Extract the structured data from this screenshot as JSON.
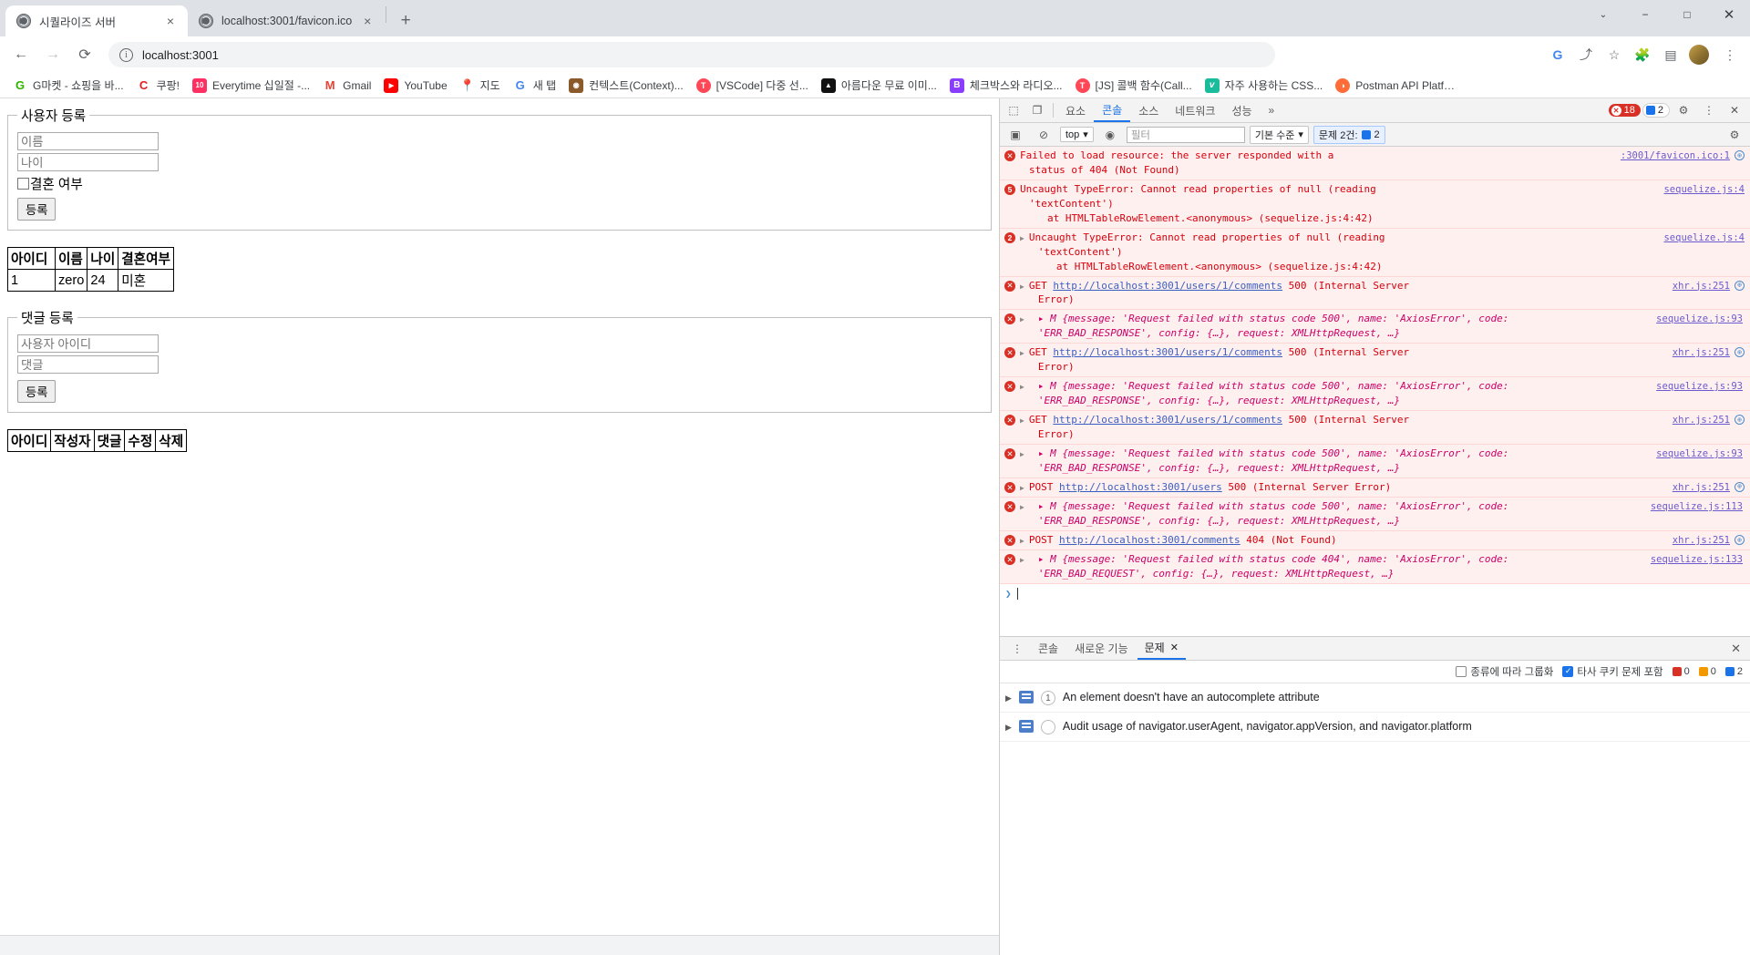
{
  "browser": {
    "tabs": [
      {
        "title": "시퀄라이즈 서버",
        "active": true,
        "close": "×"
      },
      {
        "title": "localhost:3001/favicon.ico",
        "active": false,
        "close": "×"
      }
    ],
    "new_tab_label": "+",
    "window_controls": {
      "minimize": "−",
      "maximize": "□",
      "close": "✕",
      "chevron": "⌄"
    },
    "nav": {
      "back": "←",
      "forward": "→",
      "reload": "⟳"
    },
    "omnibox": {
      "value": "localhost:3001",
      "info_icon": "ⓘ"
    },
    "toolbar_icons": [
      "google-lens-icon",
      "share-icon",
      "bookmark-star-icon",
      "extensions-icon",
      "side-panel-icon",
      "profile-avatar",
      "chrome-menu-icon"
    ],
    "bookmarks": [
      {
        "label": "G마켓 - 쇼핑을 바...",
        "icon_text": "G",
        "icon_color": "#ffffff"
      },
      {
        "label": "쿠팡!",
        "icon_text": "C",
        "icon_color": "#ffffff"
      },
      {
        "label": "Everytime 십일절 -...",
        "icon_text": "10",
        "icon_color": "#ff2e63"
      },
      {
        "label": "Gmail",
        "icon_text": "M",
        "icon_color": "#ffffff"
      },
      {
        "label": "YouTube",
        "icon_text": "▶",
        "icon_color": "#ff0000"
      },
      {
        "label": "지도",
        "icon_text": "●",
        "icon_color": "#ffffff"
      },
      {
        "label": "새 탭",
        "icon_text": "G",
        "icon_color": "#ffffff"
      },
      {
        "label": "컨텍스트(Context)...",
        "icon_text": "◉",
        "icon_color": "#ffffff"
      },
      {
        "label": "[VSCode] 다중 선...",
        "icon_text": "T",
        "icon_color": "#ff4757"
      },
      {
        "label": "아름다운 무료 이미...",
        "icon_text": "▲",
        "icon_color": "#111111"
      },
      {
        "label": "체크박스와 라디오...",
        "icon_text": "B",
        "icon_color": "#8b3dff"
      },
      {
        "label": "[JS] 콜백 함수(Call...",
        "icon_text": "T",
        "icon_color": "#ff4757"
      },
      {
        "label": "자주 사용하는 CSS...",
        "icon_text": "v",
        "icon_color": "#1abc9c"
      },
      {
        "label": "Postman API Platfo...",
        "icon_text": "◑",
        "icon_color": "#ff6c37"
      }
    ]
  },
  "page": {
    "user_form": {
      "legend": "사용자 등록",
      "name_placeholder": "이름",
      "age_placeholder": "나이",
      "married_label": "결혼 여부",
      "submit_label": "등록"
    },
    "user_table": {
      "headers": [
        "아이디",
        "이름",
        "나이",
        "결혼여부"
      ],
      "rows": [
        [
          "1",
          "zero",
          "24",
          "미혼"
        ]
      ]
    },
    "comment_form": {
      "legend": "댓글 등록",
      "userid_placeholder": "사용자 아이디",
      "comment_placeholder": "댓글",
      "submit_label": "등록"
    },
    "comment_table": {
      "headers": [
        "아이디",
        "작성자",
        "댓글",
        "수정",
        "삭제"
      ],
      "rows": []
    }
  },
  "devtools": {
    "tabs": [
      "요소",
      "콘솔",
      "소스",
      "네트워크",
      "성능"
    ],
    "active_tab": "콘솔",
    "overflow_label": "»",
    "error_badge": "18",
    "warn_badge": "2",
    "settings_icon": "⚙",
    "more_icon": "⋮",
    "close_icon": "✕",
    "filter_bar": {
      "sidebar_icon": "▣",
      "clear_icon": "⊘",
      "context": "top",
      "eye_icon": "👁",
      "filter_placeholder": "필터",
      "level": "기본 수준",
      "issues_pill": "문제 2건:",
      "issues_count": "2",
      "settings_icon": "⚙",
      "gear_icon": "⚙"
    },
    "messages": [
      {
        "icon": "x",
        "lines": [
          "Failed to load resource: the server responded with a",
          "status of 404 (Not Found)"
        ],
        "source": ":3001/favicon.ico:1",
        "globe": true
      },
      {
        "icon": "count",
        "count": "5",
        "lines": [
          "Uncaught TypeError: Cannot read properties of null (reading",
          "'textContent')"
        ],
        "stack": "at HTMLTableRowElement.<anonymous> (sequelize.js:4:42)",
        "source": "sequelize.js:4"
      },
      {
        "icon": "count",
        "count": "2",
        "expandable": true,
        "lines": [
          "Uncaught TypeError: Cannot read properties of null (reading",
          "'textContent')"
        ],
        "stack": "at HTMLTableRowElement.<anonymous> (sequelize.js:4:42)",
        "source": "sequelize.js:4"
      },
      {
        "icon": "x",
        "expandable": true,
        "method": "GET",
        "url": "http://localhost:3001/users/1/comments",
        "tail": "500 (Internal Server",
        "lines2": "Error)",
        "source": "xhr.js:251",
        "globe": true
      },
      {
        "icon": "x",
        "expandable": true,
        "object": "{message: 'Request failed with status code 500', name: 'AxiosError', code:",
        "object2": "'ERR_BAD_RESPONSE', config: {…}, request: XMLHttpRequest, …}",
        "source": "sequelize.js:93"
      },
      {
        "icon": "x",
        "expandable": true,
        "method": "GET",
        "url": "http://localhost:3001/users/1/comments",
        "tail": "500 (Internal Server",
        "lines2": "Error)",
        "source": "xhr.js:251",
        "globe": true
      },
      {
        "icon": "x",
        "expandable": true,
        "object": "{message: 'Request failed with status code 500', name: 'AxiosError', code:",
        "object2": "'ERR_BAD_RESPONSE', config: {…}, request: XMLHttpRequest, …}",
        "source": "sequelize.js:93"
      },
      {
        "icon": "x",
        "expandable": true,
        "method": "GET",
        "url": "http://localhost:3001/users/1/comments",
        "tail": "500 (Internal Server",
        "lines2": "Error)",
        "source": "xhr.js:251",
        "globe": true
      },
      {
        "icon": "x",
        "expandable": true,
        "object": "{message: 'Request failed with status code 500', name: 'AxiosError', code:",
        "object2": "'ERR_BAD_RESPONSE', config: {…}, request: XMLHttpRequest, …}",
        "source": "sequelize.js:93"
      },
      {
        "icon": "x",
        "expandable": true,
        "method": "POST",
        "url": "http://localhost:3001/users",
        "tail": "500 (Internal Server Error)",
        "source": "xhr.js:251",
        "globe": true
      },
      {
        "icon": "x",
        "expandable": true,
        "object": "{message: 'Request failed with status code 500', name: 'AxiosError', code:",
        "object2": "'ERR_BAD_RESPONSE', config: {…}, request: XMLHttpRequest, …}",
        "source": "sequelize.js:113"
      },
      {
        "icon": "x",
        "expandable": true,
        "method": "POST",
        "url": "http://localhost:3001/comments",
        "tail": "404 (Not Found)",
        "source": "xhr.js:251",
        "globe": true
      },
      {
        "icon": "x",
        "expandable": true,
        "object": "{message: 'Request failed with status code 404', name: 'AxiosError', code:",
        "object2": "'ERR_BAD_REQUEST', config: {…}, request: XMLHttpRequest, …}",
        "source": "sequelize.js:133"
      }
    ],
    "prompt_chevron": "❯",
    "drawer": {
      "more_icon": "⋮",
      "tabs": [
        "콘솔",
        "새로운 기능",
        "문제"
      ],
      "active_tab": "문제",
      "tab_close": "✕",
      "close_icon": "✕",
      "group_checkbox_label": "종류에 따라 그룹화",
      "third_party_label": "타사 쿠키 문제 포함",
      "counts": {
        "errors": "0",
        "warnings": "0",
        "info": "2"
      },
      "issues": [
        {
          "arrow": "▶",
          "count": "1",
          "text": "An element doesn't have an autocomplete attribute"
        },
        {
          "arrow": "▶",
          "count": "",
          "text": "Audit usage of navigator.userAgent, navigator.appVersion, and navigator.platform"
        }
      ]
    }
  }
}
